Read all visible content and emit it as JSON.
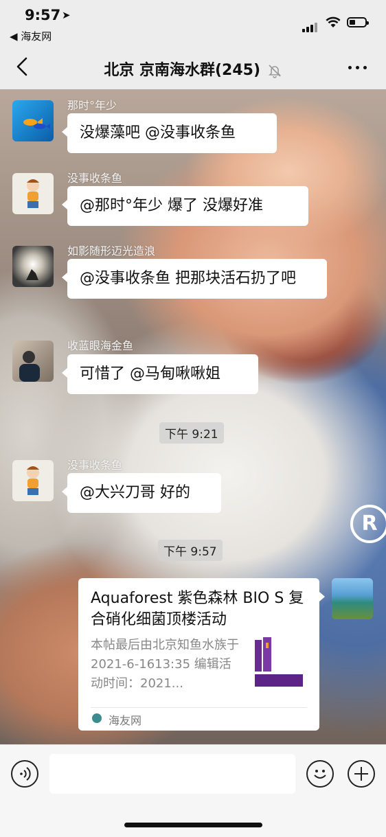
{
  "status": {
    "time": "9:57",
    "back_app": "◀ 海友网"
  },
  "header": {
    "title": "北京 京南海水群(245)"
  },
  "messages": [
    {
      "sender": "那时°年少",
      "text": "没爆藻吧 @没事收条鱼"
    },
    {
      "sender": "没事收条鱼",
      "text": "@那时°年少 爆了  没爆好准"
    },
    {
      "sender": "如影随形迈光造浪",
      "text": "@没事收条鱼 把那块活石扔了吧"
    },
    {
      "sender": "收蓝眼海金鱼",
      "text": "可惜了 @马甸啾啾姐"
    },
    {
      "timestamp": "下午 9:21"
    },
    {
      "sender": "没事收条鱼",
      "text": "@大兴刀哥 好的"
    },
    {
      "timestamp": "下午 9:57"
    }
  ],
  "link_card": {
    "title": "Aquaforest 紫色森林 BIO S 复合硝化细菌顶楼活动",
    "description": "本帖最后由北京知鱼水族于 2021-6-1613:35 编辑活动时间：2021...",
    "source": "海友网"
  },
  "input": {
    "value": "",
    "placeholder": ""
  },
  "colors": {
    "bubble": "#ffffff",
    "bar_bg": "#ededed",
    "sender_text": "#f4f4f4"
  },
  "icons": [
    "location-arrow-icon",
    "signal-icon",
    "wifi-icon",
    "battery-icon",
    "back-chevron-icon",
    "mute-bell-icon",
    "more-dots-icon",
    "voice-icon",
    "emoji-icon",
    "plus-icon"
  ]
}
